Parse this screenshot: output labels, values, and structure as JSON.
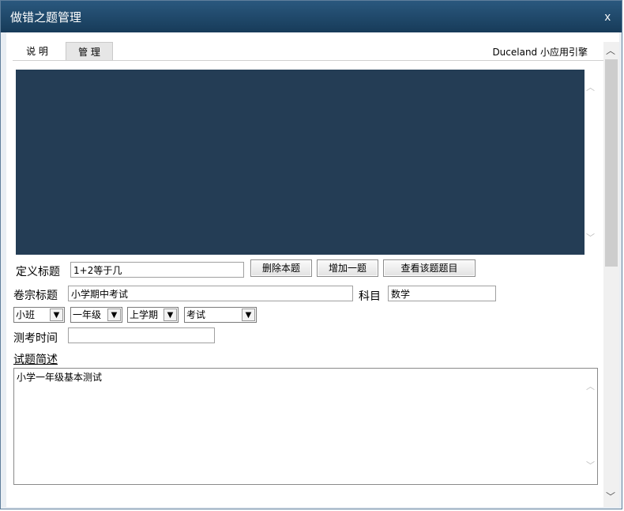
{
  "window": {
    "title": "做错之题管理",
    "close_label": "x"
  },
  "tabs": [
    {
      "label": "说 明"
    },
    {
      "label": "管 理"
    }
  ],
  "engine_label": "Duceland 小应用引擎",
  "define_title": {
    "label": "定义标题",
    "value": "1+2等于几"
  },
  "buttons": {
    "delete": "删除本题",
    "add": "增加一题",
    "view": "查看该题题目"
  },
  "paper_title": {
    "label": "卷宗标题",
    "value": "小学期中考试"
  },
  "subject": {
    "label": "科目",
    "value": "数学"
  },
  "selects": {
    "class": "小班",
    "grade": "一年级",
    "term": "上学期",
    "type": "考试"
  },
  "test_time": {
    "label": "测考时间",
    "value": ""
  },
  "description": {
    "label": "试题简述",
    "value": "小学一年级基本测试"
  },
  "icons": {
    "close": "close-icon",
    "scroll_up": "chevron-up-icon",
    "scroll_down": "chevron-down-icon",
    "dropdown": "chevron-down-icon"
  }
}
